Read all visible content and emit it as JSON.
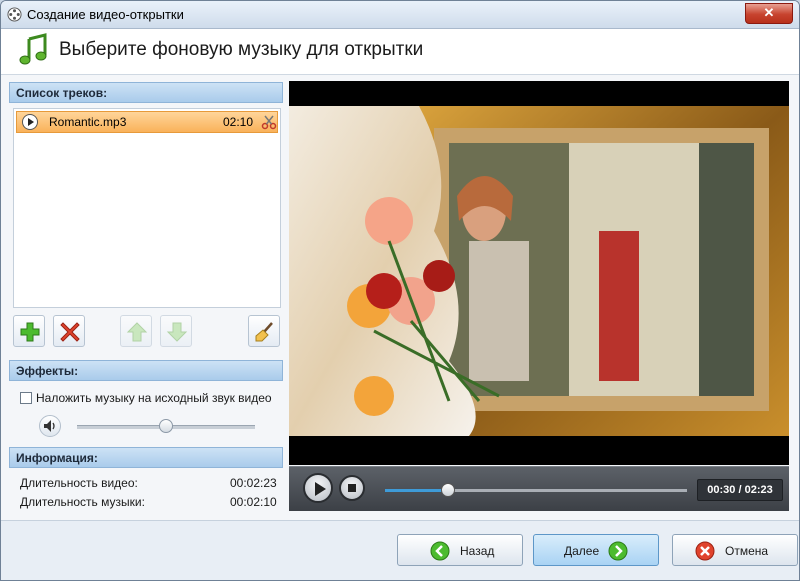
{
  "window": {
    "title": "Создание видео-открытки",
    "close_label": "✕"
  },
  "header": {
    "title": "Выберите фоновую музыку для открытки"
  },
  "tracks": {
    "heading": "Список треков:",
    "items": [
      {
        "name": "Romantic.mp3",
        "duration": "02:10"
      }
    ]
  },
  "effects": {
    "heading": "Эффекты:",
    "overlay_label": "Наложить музыку на исходный звук видео",
    "overlay_checked": false,
    "volume_level": 0.5
  },
  "info": {
    "heading": "Информация:",
    "rows": [
      {
        "label": "Длительность видео:",
        "value": "00:02:23"
      },
      {
        "label": "Длительность музыки:",
        "value": "00:02:10"
      }
    ]
  },
  "player": {
    "time": "00:30 / 02:23",
    "progress": 0.21
  },
  "footer": {
    "back_label": "Назад",
    "next_label": "Далее",
    "cancel_label": "Отмена"
  },
  "colors": {
    "accent": "#3e9bd8",
    "selection": "#f9b25a",
    "header_blue": "#a9cbeb"
  }
}
